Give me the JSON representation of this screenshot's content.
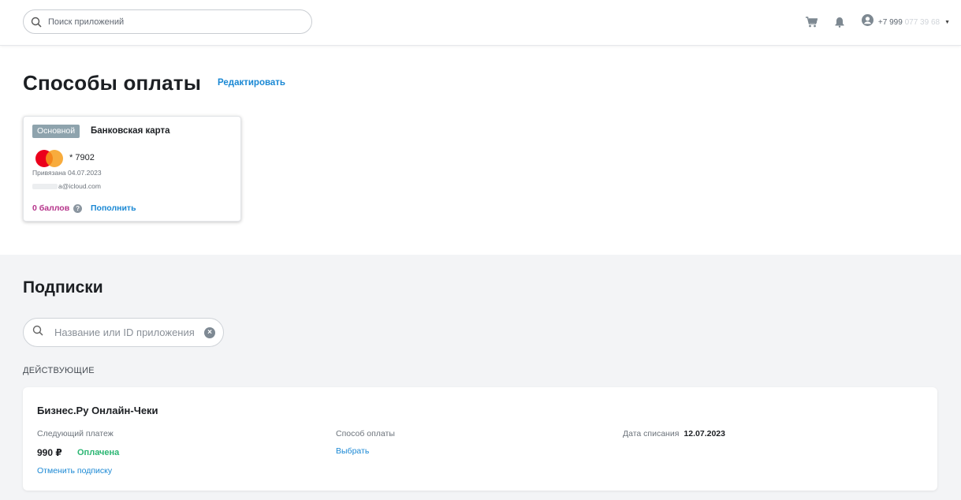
{
  "header": {
    "search_placeholder": "Поиск приложений",
    "cart_icon": "cart-icon",
    "bell_icon": "bell-icon",
    "account_icon": "account-icon",
    "phone_prefix": "+7 999",
    "phone_masked": " 077 39 68",
    "caret": "▼"
  },
  "payment_methods": {
    "title": "Способы оплаты",
    "edit_link": "Редактировать",
    "card": {
      "badge": "Основной",
      "type": "Банковская карта",
      "number": "* 7902",
      "bound_date": "Привязана 04.07.2023",
      "email": "a@icloud.com",
      "points": "0 баллов",
      "help_icon": "?",
      "topup_link": "Пополнить"
    }
  },
  "subscriptions": {
    "title": "Подписки",
    "search_placeholder": "Название или ID приложения",
    "clear_icon": "×",
    "active_label": "ДЕЙСТВУЮЩИЕ",
    "items": [
      {
        "name": "Бизнес.Ру Онлайн-Чеки",
        "next_payment_label": "Следующий платеж",
        "price": "990 ₽",
        "status": "Оплачена",
        "cancel_link": "Отменить подписку",
        "payment_method_label": "Способ оплаты",
        "choose_link": "Выбрать",
        "charge_date_label": "Дата списания",
        "charge_date": "12.07.2023"
      }
    ]
  },
  "colors": {
    "accent_link": "#1a88d4",
    "points": "#b5338a",
    "paid": "#2bb673",
    "badge": "#8ea3ad"
  }
}
